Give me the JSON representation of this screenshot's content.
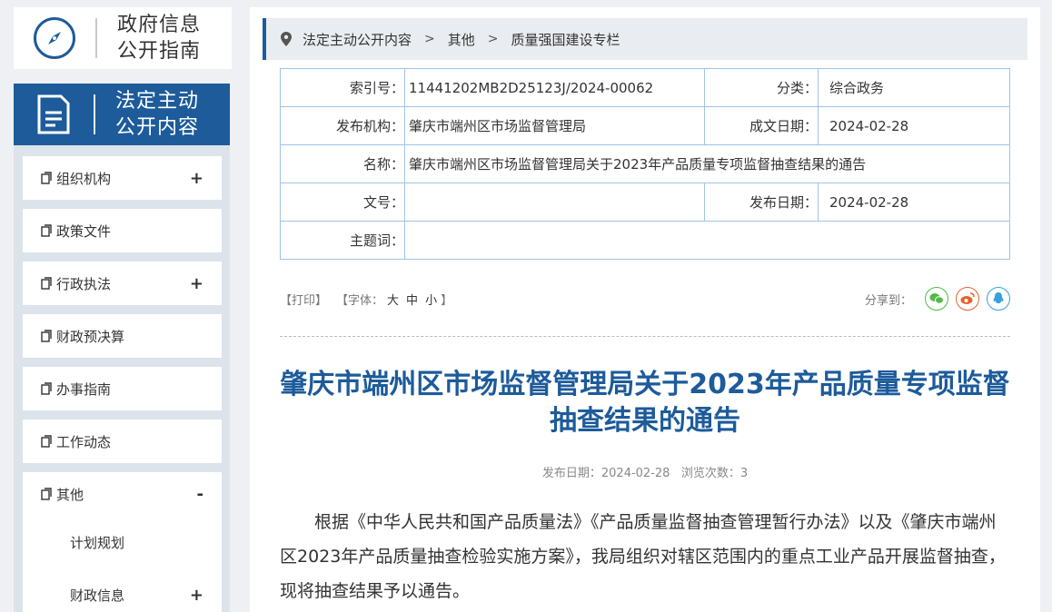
{
  "logo": {
    "line1": "政府信息",
    "line2": "公开指南"
  },
  "banner": {
    "line1": "法定主动",
    "line2": "公开内容"
  },
  "sidebar": {
    "items": [
      {
        "label": "组织机构",
        "toggle": "+"
      },
      {
        "label": "政策文件",
        "toggle": ""
      },
      {
        "label": "行政执法",
        "toggle": "+"
      },
      {
        "label": "财政预决算",
        "toggle": ""
      },
      {
        "label": "办事指南",
        "toggle": ""
      },
      {
        "label": "工作动态",
        "toggle": ""
      }
    ],
    "expanded": {
      "label": "其他",
      "toggle": "-",
      "children": [
        {
          "label": "计划规划",
          "toggle": ""
        },
        {
          "label": "财政信息",
          "toggle": "+"
        }
      ]
    }
  },
  "breadcrumb": [
    "法定主动公开内容",
    "其他",
    "质量强国建设专栏"
  ],
  "meta": {
    "index_label": "索引号：",
    "index_value": "11441202MB2D25123J/2024-00062",
    "category_label": "分类：",
    "category_value": "综合政务",
    "publisher_label": "发布机构：",
    "publisher_value": "肇庆市端州区市场监督管理局",
    "created_label": "成文日期：",
    "created_value": "2024-02-28",
    "name_label": "名称：",
    "name_value": "肇庆市端州区市场监督管理局关于2023年产品质量专项监督抽查结果的通告",
    "docno_label": "文号：",
    "docno_value": "",
    "pubdate_label": "发布日期：",
    "pubdate_value": "2024-02-28",
    "keywords_label": "主题词：",
    "keywords_value": ""
  },
  "toolbar": {
    "print": "【打印】",
    "font_prefix": "【字体：",
    "font_large": "大",
    "font_medium": "中",
    "font_small": "小",
    "font_suffix": "】",
    "share_label": "分享到："
  },
  "article": {
    "title": "肇庆市端州区市场监督管理局关于2023年产品质量专项监督抽查结果的通告",
    "pubinfo": "发布日期：2024-02-28   浏览次数：3",
    "paragraph": "根据《中华人民共和国产品质量法》《产品质量监督抽查管理暂行办法》以及《肇庆市端州区2023年产品质量抽查检验实施方案》，我局组织对辖区范围内的重点工业产品开展监督抽查，现将抽查结果予以通告。"
  },
  "colors": {
    "brand": "#1d5b9a",
    "wechat": "#52b948",
    "weibo": "#e6612b",
    "qq": "#3aa0dc"
  }
}
